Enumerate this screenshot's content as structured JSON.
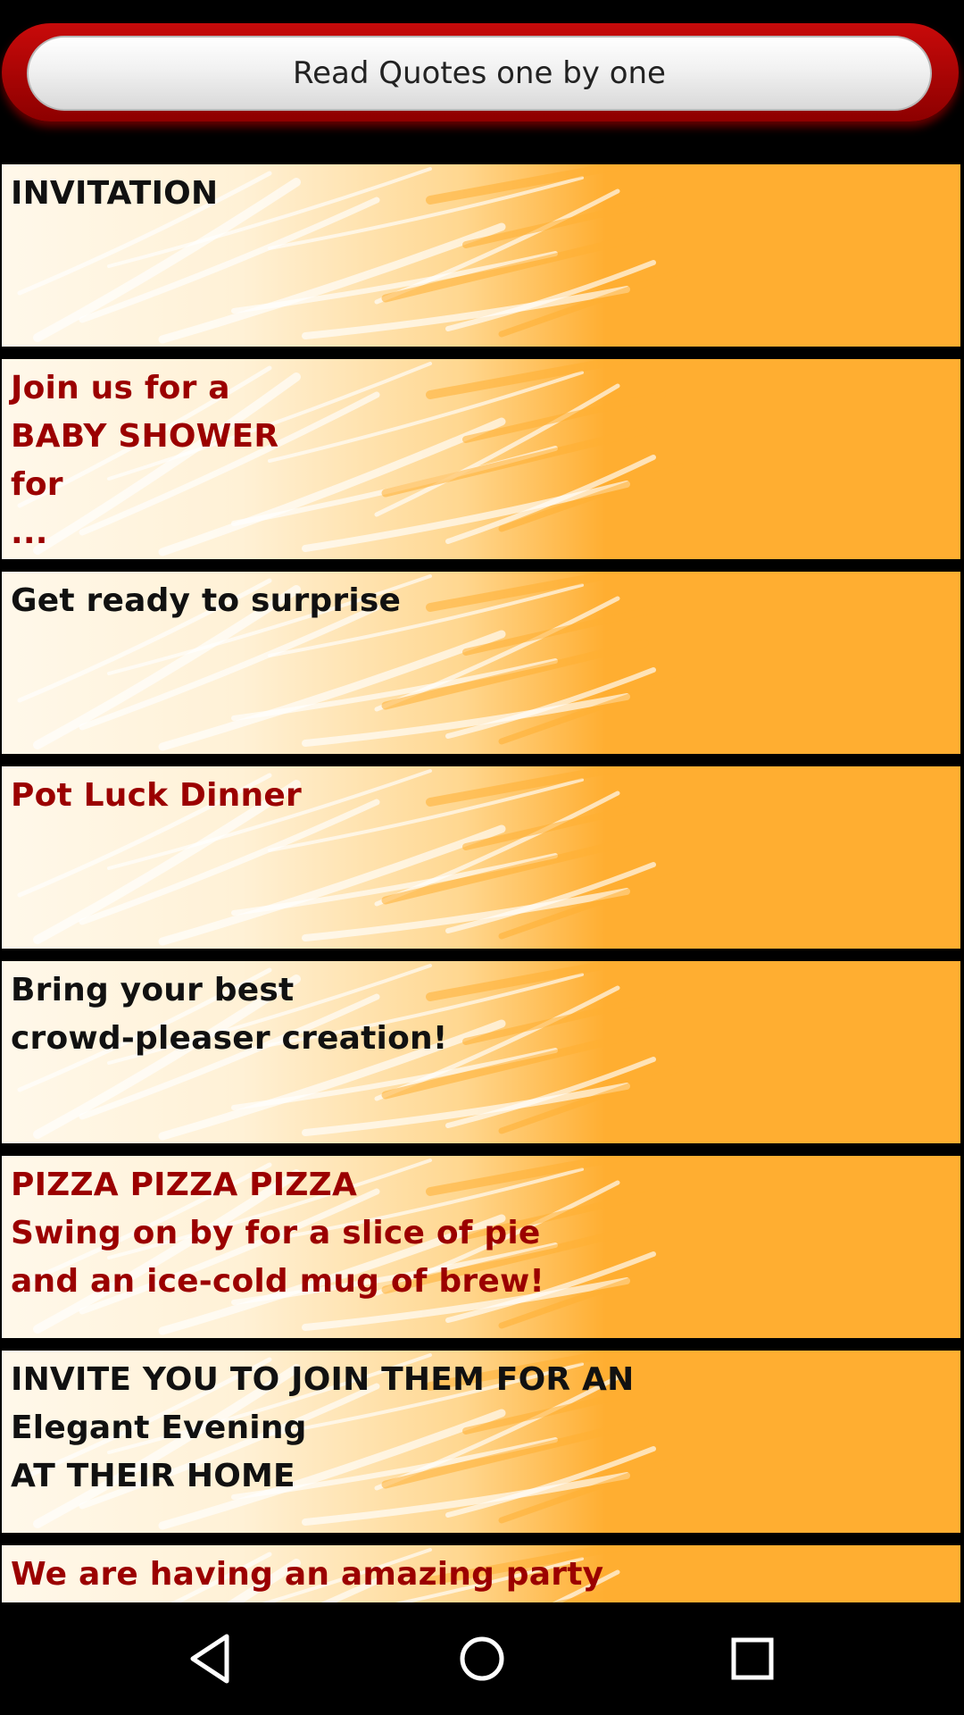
{
  "header": {
    "button_label": "Read Quotes one by one"
  },
  "quotes": [
    {
      "text": "INVITATION",
      "color": "dark"
    },
    {
      "text": "Join us for a\nBABY SHOWER\nfor\n...",
      "color": "red"
    },
    {
      "text": "Get ready to surprise",
      "color": "dark"
    },
    {
      "text": "Pot Luck Dinner",
      "color": "red"
    },
    {
      "text": "Bring your best\ncrowd-pleaser creation!",
      "color": "dark"
    },
    {
      "text": "PIZZA PIZZA PIZZA\nSwing on by for a slice of pie\nand an ice-cold mug of brew!",
      "color": "red"
    },
    {
      "text": "INVITE YOU TO JOIN THEM FOR AN\nElegant Evening\nAT THEIR HOME",
      "color": "dark"
    },
    {
      "text": "We are having an amazing party",
      "color": "red"
    }
  ],
  "navbar": {
    "back_icon": "back-triangle-icon",
    "home_icon": "home-circle-icon",
    "recents_icon": "recents-square-icon"
  },
  "colors": {
    "card_orange": "#ffae31",
    "text_red": "#9b0000",
    "text_dark": "#111111",
    "header_red": "#c80a0a"
  }
}
